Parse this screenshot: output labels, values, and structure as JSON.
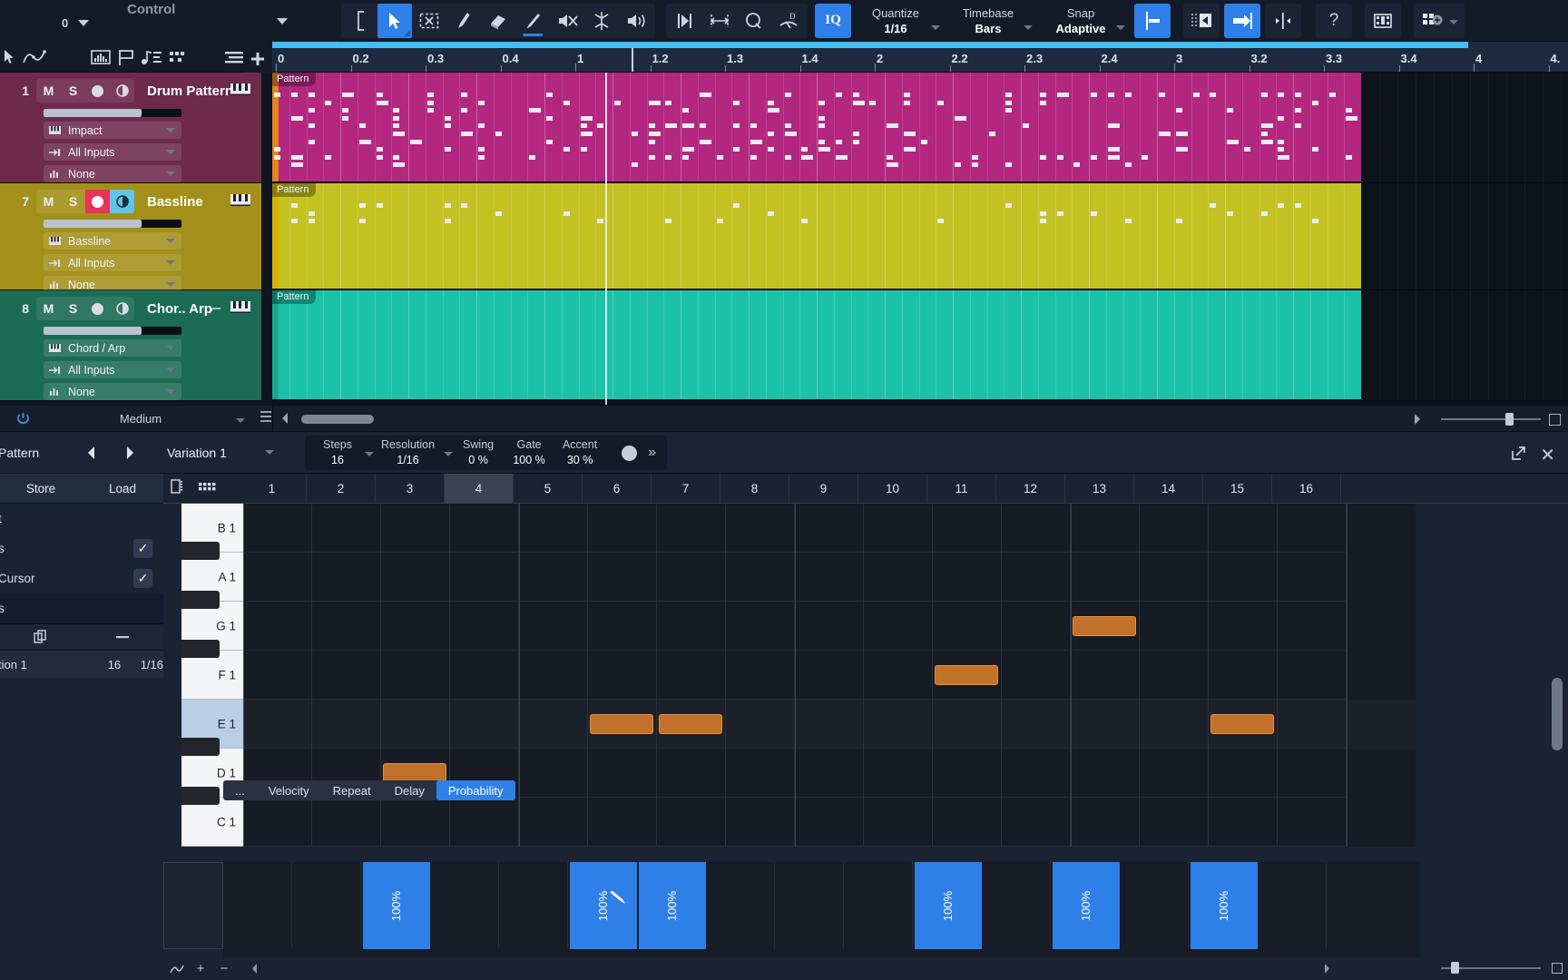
{
  "toolbar": {
    "control_label": "Control",
    "control_value": "0",
    "tools": [
      {
        "name": "bracket-icon",
        "label": "Bracket",
        "state": "normal"
      },
      {
        "name": "arrow-tool-icon",
        "label": "Arrow",
        "state": "active"
      },
      {
        "name": "range-tool-icon",
        "label": "Range",
        "state": "normal"
      },
      {
        "name": "split-tool-icon",
        "label": "Split",
        "state": "normal"
      },
      {
        "name": "eraser-tool-icon",
        "label": "Erase",
        "state": "normal"
      },
      {
        "name": "paint-tool-icon",
        "label": "Paint",
        "state": "underline"
      },
      {
        "name": "mute-tool-icon",
        "label": "Mute",
        "state": "normal"
      },
      {
        "name": "bend-tool-icon",
        "label": "Bend",
        "state": "normal"
      },
      {
        "name": "listen-tool-icon",
        "label": "Listen",
        "state": "normal"
      }
    ],
    "nav_tools": [
      {
        "name": "snap-start-icon",
        "label": "Snap Start"
      },
      {
        "name": "stretch-icon",
        "label": "Stretch"
      },
      {
        "name": "zoom-tool-icon",
        "label": "Zoom"
      },
      {
        "name": "mute-events-icon",
        "label": "Mute Events"
      }
    ],
    "iq_label": "IQ",
    "quantize": {
      "caption": "Quantize",
      "value": "1/16"
    },
    "timebase": {
      "caption": "Timebase",
      "value": "Bars"
    },
    "snap": {
      "caption": "Snap",
      "value": "Adaptive"
    },
    "right_buttons": [
      {
        "name": "snap-to-grid-icon",
        "label": "Grid",
        "state": "active"
      },
      {
        "name": "grid-left-icon",
        "label": "Grid Left",
        "state": "normal"
      },
      {
        "name": "arrow-right-bar-icon",
        "label": "To End",
        "state": "active"
      },
      {
        "name": "center-spread-icon",
        "label": "Spread",
        "state": "normal"
      },
      {
        "name": "help-icon",
        "label": "?",
        "state": "normal"
      },
      {
        "name": "film-strip-icon",
        "label": "Video",
        "state": "normal"
      },
      {
        "name": "mixer-grid-icon",
        "label": "Mix",
        "state": "normal"
      }
    ]
  },
  "arranger_tools": [
    {
      "name": "pointer-small-icon",
      "label": "Pointer"
    },
    {
      "name": "automation-curve-icon",
      "label": "Automation"
    },
    {
      "name": "audio-part-icon",
      "label": "Audio Part"
    },
    {
      "name": "marker-flag-icon",
      "label": "Marker"
    },
    {
      "name": "note-list-icon",
      "label": "Note List"
    },
    {
      "name": "pattern-grid-icon",
      "label": "Pattern"
    },
    {
      "name": "list-lines-icon",
      "label": "List"
    },
    {
      "name": "add-track-icon",
      "label": "Add Track"
    }
  ],
  "ruler": {
    "labels": [
      "0",
      "0.2",
      "0.3",
      "0.4",
      "1",
      "1.2",
      "1.3",
      "1.4",
      "2",
      "2.2",
      "2.3",
      "2.4",
      "3",
      "3.2",
      "3.3",
      "3.4",
      "4",
      "4."
    ],
    "loop_color": "#43bdf2"
  },
  "tracks": [
    {
      "number": "1",
      "name": "Drum Pattern",
      "color": "#6d2a4b",
      "clip_color": "#b3277f",
      "clip_label": "Pattern",
      "mute": "M",
      "solo": "S",
      "record_armed": false,
      "monitor_on": false,
      "instrument": "Impact",
      "input": "All Inputs",
      "output": "None",
      "has_automation_icon": false
    },
    {
      "number": "7",
      "name": "Bassline",
      "color": "#a3901a",
      "clip_color": "#c4c222",
      "clip_label": "Pattern",
      "mute": "M",
      "solo": "S",
      "record_armed": true,
      "monitor_on": true,
      "instrument": "Bassline",
      "input": "All Inputs",
      "output": "None",
      "has_automation_icon": false
    },
    {
      "number": "8",
      "name": "Chor.. Arp",
      "color": "#1c6b54",
      "clip_color": "#1cc2a8",
      "clip_label": "Pattern",
      "mute": "M",
      "solo": "S",
      "record_armed": false,
      "monitor_on": false,
      "instrument": "Chord / Arp",
      "input": "All Inputs",
      "output": "None",
      "has_automation_icon": true
    }
  ],
  "low_strip": {
    "power_icon": "power-icon",
    "performance": "Medium",
    "list_icon": "list-icon"
  },
  "pattern_editor": {
    "title": "Pattern",
    "prev_icon": "prev-variation-icon",
    "next_icon": "next-variation-icon",
    "variation": "Variation 1",
    "params": [
      {
        "caption": "Steps",
        "value": "16",
        "has_dropdown": true
      },
      {
        "caption": "Resolution",
        "value": "1/16",
        "has_dropdown": true
      },
      {
        "caption": "Swing",
        "value": "0 %",
        "has_dropdown": false
      },
      {
        "caption": "Gate",
        "value": "100 %",
        "has_dropdown": false
      },
      {
        "caption": "Accent",
        "value": "30 %",
        "has_dropdown": false
      }
    ],
    "knob_icon": "accent-knob-icon",
    "chevron_icon": "chevrons-right-icon",
    "expand_icon": "expand-icon",
    "close_icon": "close-icon",
    "left_panel": {
      "store": "Store",
      "load": "Load",
      "rows": [
        {
          "label": "t",
          "checked": false,
          "selected": false
        },
        {
          "label": "s",
          "checked": true,
          "selected": false
        },
        {
          "label": "Cursor",
          "checked": true,
          "selected": false
        },
        {
          "label": "s",
          "checked": false,
          "selected": true
        }
      ],
      "toolbar_icons": [
        "duplicate-icon",
        "remove-icon"
      ],
      "list_item": {
        "name": "tion 1",
        "steps": "16",
        "resolution": "1/16"
      }
    },
    "grid_icons": [
      "list-view-icon",
      "grid-view-icon"
    ],
    "steps": [
      "1",
      "2",
      "3",
      "4",
      "5",
      "6",
      "7",
      "8",
      "9",
      "10",
      "11",
      "12",
      "13",
      "14",
      "15",
      "16"
    ],
    "selected_step": "4",
    "keys": [
      "B 1",
      "A 1",
      "G 1",
      "F 1",
      "E 1",
      "D 1",
      "C 1"
    ],
    "highlighted_key": "E 1",
    "notes": [
      {
        "step": 3,
        "key": "D 1",
        "length": 1
      },
      {
        "step": 6,
        "key": "E 1",
        "length": 1
      },
      {
        "step": 7,
        "key": "E 1",
        "length": 1
      },
      {
        "step": 11,
        "key": "F 1",
        "length": 1
      },
      {
        "step": 13,
        "key": "G 1",
        "length": 1
      },
      {
        "step": 15,
        "key": "E 1",
        "length": 1
      }
    ],
    "note_color": "#c1712a",
    "lane_tabs": [
      {
        "label": "...",
        "active": false
      },
      {
        "label": "Velocity",
        "active": false
      },
      {
        "label": "Repeat",
        "active": false
      },
      {
        "label": "Delay",
        "active": false
      },
      {
        "label": "Probability",
        "active": true
      }
    ],
    "automation_values": [
      {
        "step": 3,
        "value": "100%"
      },
      {
        "step": 6,
        "value": "100%",
        "has_pencil": true
      },
      {
        "step": 7,
        "value": "100%"
      },
      {
        "step": 11,
        "value": "100%"
      },
      {
        "step": 13,
        "value": "100%"
      },
      {
        "step": 15,
        "value": "100%"
      }
    ],
    "automation_color": "#2f7fe8",
    "bottom_icons": [
      "curve-icon",
      "plus-icon",
      "minus-icon"
    ]
  }
}
